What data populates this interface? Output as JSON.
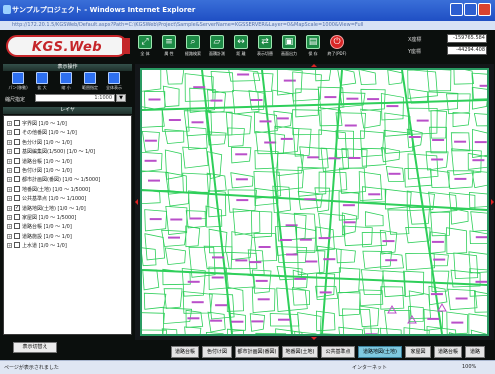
{
  "window": {
    "title": "サンプルプロジェクト - Windows Internet Explorer",
    "address": "http://172.20.1.5/KGSWeb/Default.aspx?Path=C:\\KGSWeb\\Project\\Sample&ServerName=KGSSERVER&Layer=0&MapScale=1000&View=Full"
  },
  "app": {
    "logo": "KGS.Web",
    "toolbar": [
      {
        "label": "全 体",
        "icon": "full-extent"
      },
      {
        "label": "属 性",
        "icon": "attribute"
      },
      {
        "label": "経路検索",
        "icon": "route-search"
      },
      {
        "label": "面積計測",
        "icon": "area-measure"
      },
      {
        "label": "距 離",
        "icon": "distance"
      },
      {
        "label": "表示切替",
        "icon": "display-switch"
      },
      {
        "label": "画面出力",
        "icon": "screen-output"
      },
      {
        "label": "保 存",
        "icon": "save"
      },
      {
        "label": "終了(PDF)",
        "icon": "exit"
      }
    ],
    "coords": {
      "x_label": "X座標",
      "x_value": "-159765.584",
      "y_label": "Y座標",
      "y_value": "-44294.408"
    }
  },
  "sidebar": {
    "ops_title": "表示操作",
    "ops": [
      {
        "label": "パン(移動)"
      },
      {
        "label": "拡 大"
      },
      {
        "label": "縮 小"
      },
      {
        "label": "範囲指定"
      },
      {
        "label": "全体表示"
      }
    ],
    "scale_label": "縮尺指定",
    "scale_value": "1:1000",
    "scale_btn": "▼",
    "layers_title": "レイヤ",
    "layers": [
      {
        "name": "字界図 [1/0 ～ 1/0]",
        "checked": false
      },
      {
        "name": "その他番図 [1/0 ～ 1/0]",
        "checked": false
      },
      {
        "name": "色分け図 [1/0 ～ 1/0]",
        "checked": false
      },
      {
        "name": "基図編集図(1/500) [1/0 ～ 1/0]",
        "checked": false
      },
      {
        "name": "道路台帳 [1/0 ～ 1/0]",
        "checked": false
      },
      {
        "name": "色付け図 [1/0 ～ 1/0]",
        "checked": false
      },
      {
        "name": "都市計画図(番図) [1/0 ～ 1/5000]",
        "checked": false
      },
      {
        "name": "地番図(土地) [1/0 ～ 1/5000]",
        "checked": false
      },
      {
        "name": "公共基準点 [1/0 ～ 1/1000]",
        "checked": false
      },
      {
        "name": "道路地図(土地) [1/0 ～ 1/0]",
        "checked": true
      },
      {
        "name": "家屋図 [1/0 ～ 1/5000]",
        "checked": false
      },
      {
        "name": "道路台帳 [1/0 ～ 1/0]",
        "checked": false
      },
      {
        "name": "道路施設 [1/0 ～ 1/0]",
        "checked": false
      },
      {
        "name": "上水道 [1/0 ～ 1/0]",
        "checked": false
      }
    ],
    "toggle_button": "表示切替え"
  },
  "tabs": [
    {
      "label": "道路台帳",
      "active": false
    },
    {
      "label": "色付け図",
      "active": false
    },
    {
      "label": "都市計画図(番図)",
      "active": false
    },
    {
      "label": "地番図(土地)",
      "active": false
    },
    {
      "label": "公共基準点",
      "active": false
    },
    {
      "label": "道路地図(土地)",
      "active": true
    },
    {
      "label": "家屋図",
      "active": false
    },
    {
      "label": "道路台帳",
      "active": false
    },
    {
      "label": "道路",
      "active": false
    }
  ],
  "status": {
    "left": "ページが表示されました",
    "zone": "インターネット",
    "zoom": "100%"
  },
  "colors": {
    "parcel_line": "#2fcf5a",
    "label": "#b94fc9",
    "frame": "#2a9b63",
    "active_tab": "#7fc9e0"
  }
}
